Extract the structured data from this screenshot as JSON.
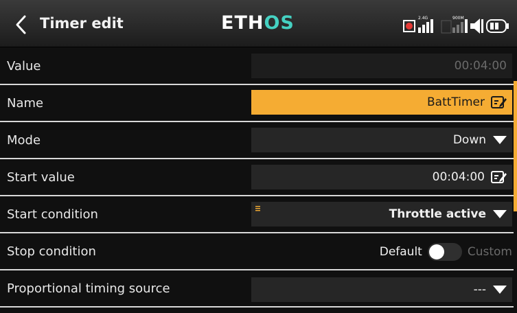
{
  "header": {
    "title": "Timer edit",
    "logo_part1": "ETH",
    "logo_part2": "OS",
    "status_icons": [
      "record-indicator-icon",
      "signal-2-4ghz-icon",
      "signal-900mhz-icon",
      "volume-icon",
      "battery-icon"
    ],
    "status_labels": {
      "band1": "2.4G",
      "band2": "900M"
    }
  },
  "rows": {
    "value": {
      "label": "Value",
      "field": "00:04:00"
    },
    "name": {
      "label": "Name",
      "field": "BattTimer"
    },
    "mode": {
      "label": "Mode",
      "field": "Down"
    },
    "start_value": {
      "label": "Start value",
      "field": "00:04:00"
    },
    "start_condition": {
      "label": "Start condition",
      "field": "Throttle active"
    },
    "stop_condition": {
      "label": "Stop condition",
      "left_option": "Default",
      "right_option": "Custom"
    },
    "proportional": {
      "label": "Proportional timing source",
      "field": "---"
    }
  },
  "colors": {
    "accent": "#f5ac33",
    "logo_accent": "#45d1c2",
    "field_bg": "#262626",
    "disabled_text": "#6a6a6a"
  }
}
